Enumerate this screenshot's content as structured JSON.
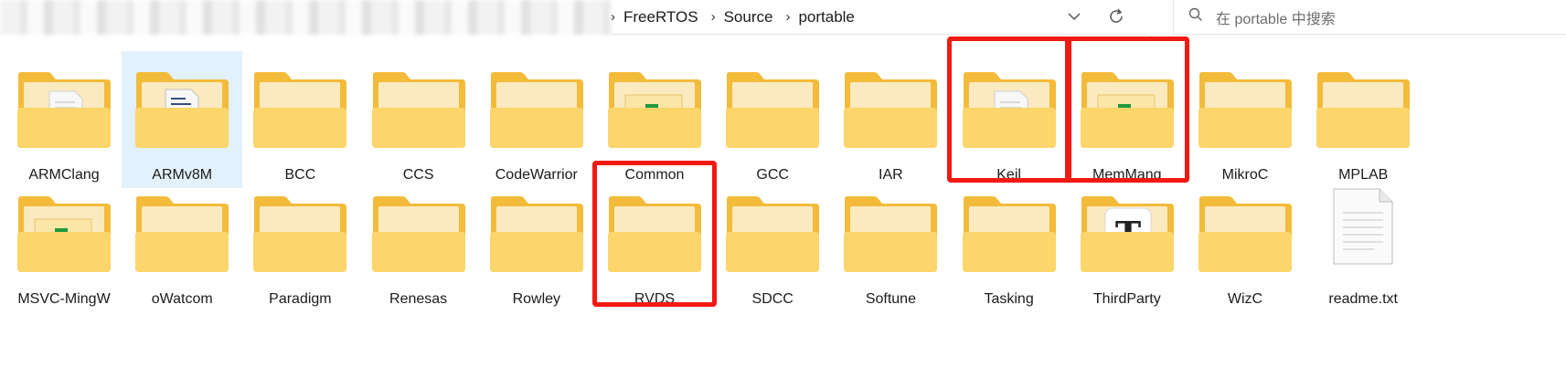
{
  "address": {
    "crumbs": [
      "FreeRTOS",
      "Source",
      "portable"
    ],
    "dropdown_icon": "chevron-down-icon",
    "refresh_icon": "refresh-icon"
  },
  "search": {
    "placeholder": "在 portable 中搜索",
    "icon": "search-icon"
  },
  "row1": [
    {
      "name": "ARMClang",
      "overlay": "doc"
    },
    {
      "name": "ARMv8M",
      "overlay": "doc-blue",
      "selected": true
    },
    {
      "name": "BCC",
      "overlay": "none"
    },
    {
      "name": "CCS",
      "overlay": "none"
    },
    {
      "name": "CodeWarrior",
      "overlay": "none"
    },
    {
      "name": "Common",
      "overlay": "green"
    },
    {
      "name": "GCC",
      "overlay": "none"
    },
    {
      "name": "IAR",
      "overlay": "none"
    },
    {
      "name": "Keil",
      "overlay": "doc",
      "highlighted": true
    },
    {
      "name": "MemMang",
      "overlay": "green",
      "highlighted": true
    },
    {
      "name": "MikroC",
      "overlay": "none"
    },
    {
      "name": "MPLAB",
      "overlay": "none"
    }
  ],
  "row2": [
    {
      "name": "MSVC-MingW",
      "overlay": "green"
    },
    {
      "name": "oWatcom",
      "overlay": "none"
    },
    {
      "name": "Paradigm",
      "overlay": "none"
    },
    {
      "name": "Renesas",
      "overlay": "none"
    },
    {
      "name": "Rowley",
      "overlay": "none"
    },
    {
      "name": "RVDS",
      "overlay": "none",
      "highlighted": true
    },
    {
      "name": "SDCC",
      "overlay": "none"
    },
    {
      "name": "Softune",
      "overlay": "none"
    },
    {
      "name": "Tasking",
      "overlay": "none"
    },
    {
      "name": "ThirdParty",
      "overlay": "font-t"
    },
    {
      "name": "WizC",
      "overlay": "none"
    },
    {
      "name": "readme.txt",
      "type": "file"
    }
  ],
  "colors": {
    "folder_back": "#f3bb3a",
    "folder_front": "#fcd56b",
    "highlight": "#f01a12",
    "selection": "#e3f1fd"
  }
}
